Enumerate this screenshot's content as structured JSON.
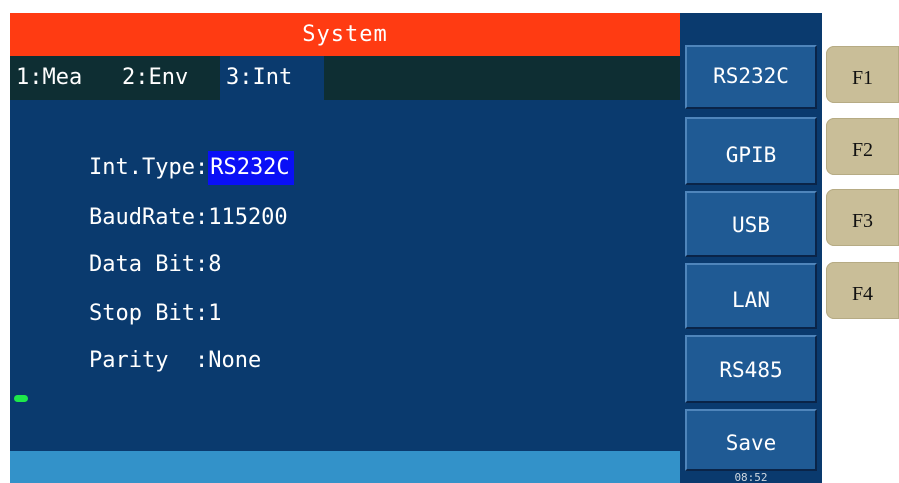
{
  "title": "System",
  "tabs": [
    {
      "label": "1:Mea"
    },
    {
      "label": "2:Env"
    },
    {
      "label": "3:Int"
    }
  ],
  "settings": {
    "int_type": {
      "label": "Int.Type:",
      "value": "RS232C"
    },
    "baud_rate": {
      "label": "BaudRate:",
      "value": "115200"
    },
    "data_bit": {
      "label": "Data Bit:",
      "value": "8"
    },
    "stop_bit": {
      "label": "Stop Bit:",
      "value": "1"
    },
    "parity": {
      "label": "Parity  :",
      "value": "None"
    }
  },
  "softkeys": [
    {
      "label": "RS232C"
    },
    {
      "label": "GPIB"
    },
    {
      "label": "USB"
    },
    {
      "label": "LAN"
    },
    {
      "label": "RS485"
    },
    {
      "label": "Save"
    }
  ],
  "clock": "08:52",
  "function_keys": [
    {
      "label": "F1"
    },
    {
      "label": "F2"
    },
    {
      "label": "F3"
    },
    {
      "label": "F4"
    }
  ],
  "colors": {
    "title_bar": "#ff3b12",
    "screen_bg": "#0a3a6e",
    "selection": "#0a10f6",
    "status_bar": "#3392c9",
    "usb_indicator": "#1ee84a",
    "function_key": "#c9be98"
  },
  "icons": {
    "usb_indicator": "usb-connected-icon"
  }
}
